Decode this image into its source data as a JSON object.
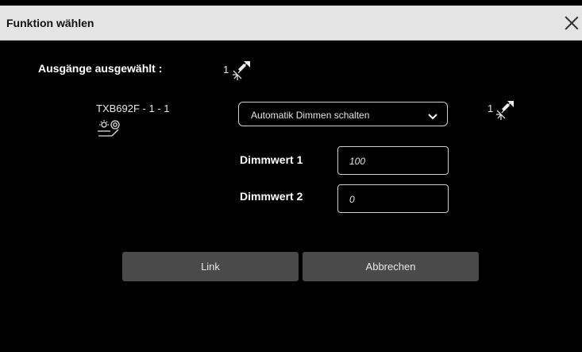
{
  "dialog": {
    "title": "Funktion wählen",
    "close_icon": "close-x-icon"
  },
  "selection": {
    "label": "Ausgänge ausgewählt :",
    "count": "1",
    "icon": "light-switch-icon"
  },
  "device": {
    "name": "TXB692F - 1 - 1",
    "icon": "dimmer-light-icon"
  },
  "function": {
    "selected": "Automatik Dimmen schalten",
    "count": "1",
    "icon": "light-switch-icon"
  },
  "fields": {
    "dimm1_label": "Dimmwert 1",
    "dimm1_value": "100",
    "dimm2_label": "Dimmwert 2",
    "dimm2_value": "0"
  },
  "buttons": {
    "link": "Link",
    "cancel": "Abbrechen"
  }
}
